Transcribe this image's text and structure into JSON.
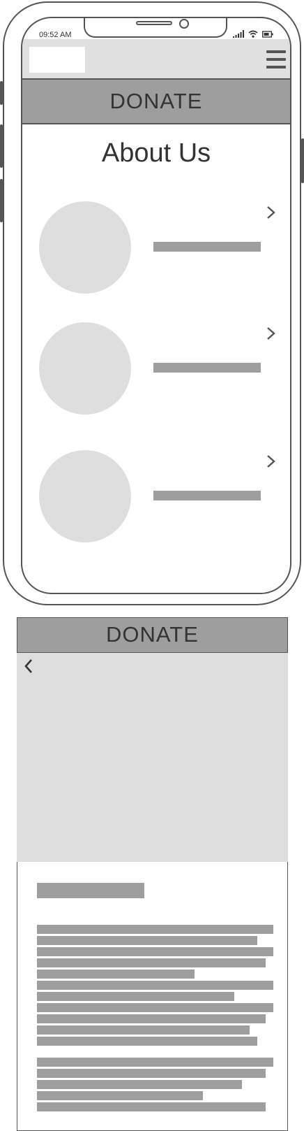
{
  "status_bar": {
    "time": "09:52 AM"
  },
  "header": {
    "logo_name": "logo-placeholder",
    "menu_icon": "hamburger-menu-icon"
  },
  "banner": {
    "label": "DONATE"
  },
  "page": {
    "title": "About Us"
  },
  "team": [
    {
      "icon": "chevron-right-icon"
    },
    {
      "icon": "chevron-right-icon"
    },
    {
      "icon": "chevron-right-icon"
    }
  ],
  "detail": {
    "banner_label": "DONATE",
    "back_icon": "chevron-left-icon"
  },
  "colors": {
    "bar": "#9e9e9e",
    "placeholder": "#dedede",
    "outline": "#555555"
  }
}
